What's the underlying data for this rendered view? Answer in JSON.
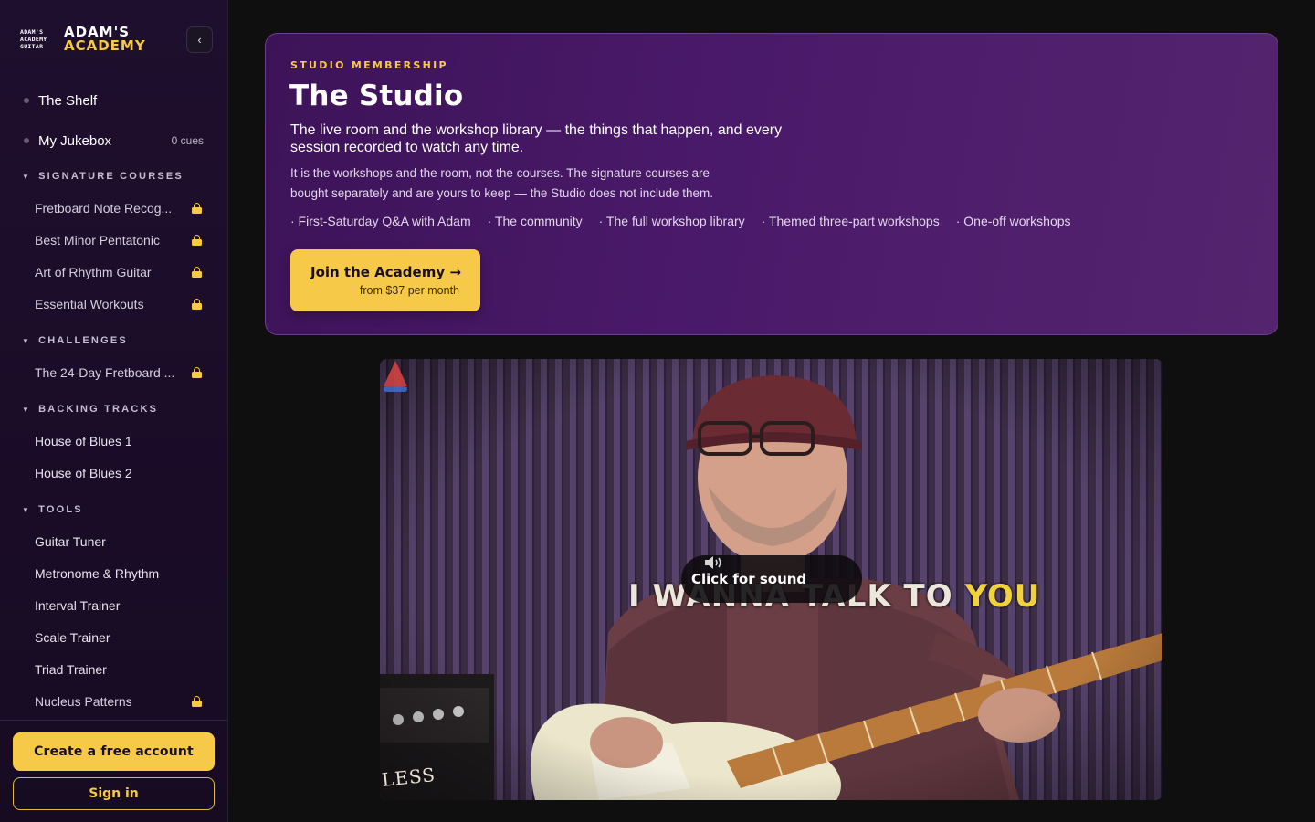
{
  "brand": {
    "logo_lines": [
      "ADAM'S",
      "ACADEMY",
      "GUITAR"
    ],
    "line1": "ADAM'S",
    "line2": "ACADEMY"
  },
  "sidebar": {
    "collapse_glyph": "‹",
    "top_items": [
      {
        "label": "The Shelf",
        "meta": ""
      },
      {
        "label": "My Jukebox",
        "meta": "0 cues"
      }
    ],
    "sections": [
      {
        "title": "SIGNATURE COURSES",
        "items": [
          {
            "label": "Fretboard Note Recog...",
            "locked": true
          },
          {
            "label": "Best Minor Pentatonic",
            "locked": true
          },
          {
            "label": "Art of Rhythm Guitar",
            "locked": true
          },
          {
            "label": "Essential Workouts",
            "locked": true
          }
        ]
      },
      {
        "title": "CHALLENGES",
        "items": [
          {
            "label": "The 24-Day Fretboard ...",
            "locked": true
          }
        ]
      },
      {
        "title": "BACKING TRACKS",
        "items": [
          {
            "label": "House of Blues 1",
            "locked": false
          },
          {
            "label": "House of Blues 2",
            "locked": false
          }
        ]
      },
      {
        "title": "TOOLS",
        "items": [
          {
            "label": "Guitar Tuner",
            "locked": false
          },
          {
            "label": "Metronome & Rhythm",
            "locked": false
          },
          {
            "label": "Interval Trainer",
            "locked": false
          },
          {
            "label": "Scale Trainer",
            "locked": false
          },
          {
            "label": "Triad Trainer",
            "locked": false
          },
          {
            "label": "Nucleus Patterns",
            "locked": true
          }
        ]
      }
    ],
    "create_account_label": "Create a free account",
    "sign_in_label": "Sign in"
  },
  "hero": {
    "eyebrow": "STUDIO MEMBERSHIP",
    "title": "The Studio",
    "lead": "The live room and the workshop library — the things that happen, and every session recorded to watch any time.",
    "sub": "It is the workshops and the room, not the courses. The signature courses are bought separately and are yours to keep — the Studio does not include them.",
    "features": [
      "· First-Saturday Q&A with Adam",
      "· The community",
      "· The full workshop library",
      "· Themed three-part workshops",
      "· One-off workshops"
    ],
    "cta_label": "Join the Academy →",
    "cta_sub": "from $37 per month"
  },
  "video": {
    "sound_label": "Click for sound",
    "caption_white": "I WANNA TALK TO",
    "caption_yellow": "YOU",
    "amp_text": "LESS"
  },
  "colors": {
    "accent": "#f7c948",
    "hero_bg": "#4a1a6a",
    "sidebar_bg": "#1f0f2e",
    "page_bg": "#0f0f10"
  }
}
